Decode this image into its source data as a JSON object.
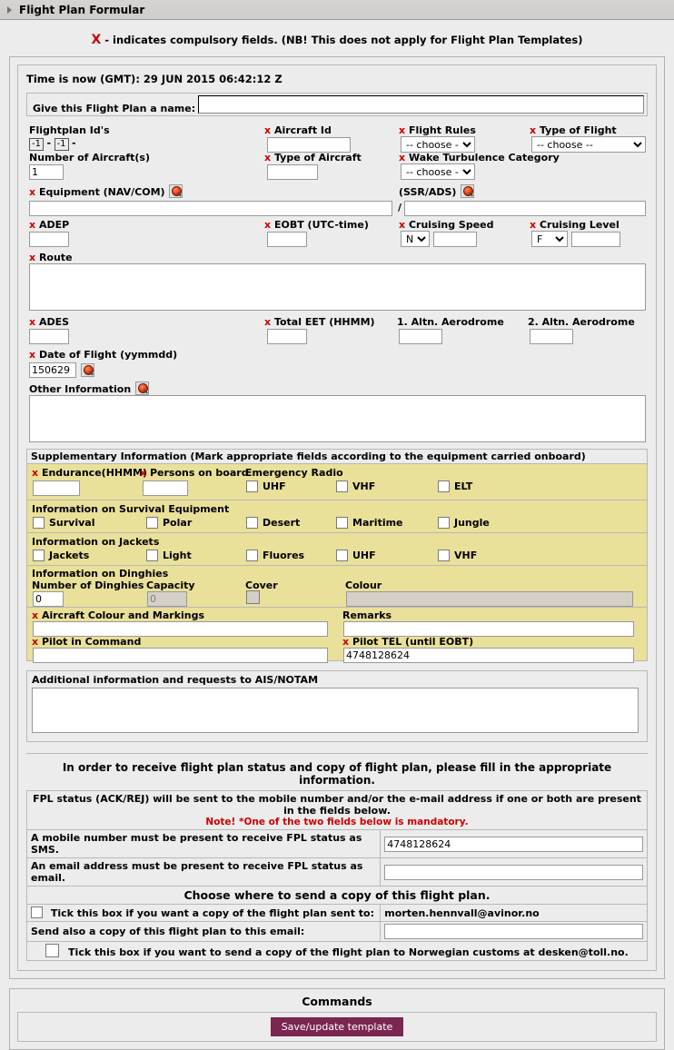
{
  "window": {
    "title": "Flight Plan Formular",
    "expander_icon": "triangle-right-icon"
  },
  "notice": {
    "xmark": "X",
    "text": "- indicates compulsory fields. (NB! This does not apply for Flight Plan Templates)"
  },
  "header": {
    "time_label": "Time is now (GMT): 29 JUN 2015 06:42:12 Z",
    "name_label": "Give this Flight Plan a name:",
    "name_value": ""
  },
  "fields": {
    "flightplan_ids_label": "Flightplan Id's",
    "flightplan_id_1": "-1",
    "flightplan_id_2": "-1",
    "flightplan_id_sep": "-",
    "flightplan_id_tail": "-",
    "aircraft_id_label": "Aircraft Id",
    "aircraft_id_value": "",
    "flight_rules_label": "Flight Rules",
    "flight_rules_value": "-- choose --",
    "type_of_flight_label": "Type of Flight",
    "type_of_flight_value": "-- choose --",
    "number_of_aircraft_label": "Number of Aircraft(s)",
    "number_of_aircraft_value": "1",
    "type_of_aircraft_label": "Type of Aircraft",
    "type_of_aircraft_value": "",
    "wake_turbulence_label": "Wake Turbulence Category",
    "wake_turbulence_value": "-- choose --",
    "equipment_label": "Equipment (NAV/COM)",
    "equipment_value": "",
    "ssr_ads_label": "(SSR/ADS)",
    "ssr_ads_sep": "/",
    "ssr_ads_value": "",
    "adep_label": "ADEP",
    "adep_value": "",
    "eobt_label": "EOBT (UTC-time)",
    "eobt_value": "",
    "cruising_speed_label": "Cruising Speed",
    "cruising_speed_prefix": "N",
    "cruising_speed_value": "",
    "cruising_level_label": "Cruising Level",
    "cruising_level_prefix": "F",
    "cruising_level_value": "",
    "route_label": "Route",
    "route_value": "",
    "ades_label": "ADES",
    "ades_value": "",
    "total_eet_label": "Total EET (HHMM)",
    "total_eet_value": "",
    "altn1_label": "1. Altn. Aerodrome",
    "altn1_value": "",
    "altn2_label": "2. Altn. Aerodrome",
    "altn2_value": "",
    "date_of_flight_label": "Date of Flight (yymmdd)",
    "date_of_flight_value": "150629",
    "other_information_label": "Other Information",
    "other_information_value": "",
    "magnifier_icon": "magnifier-icon"
  },
  "supplementary": {
    "heading": "Supplementary Information (Mark appropriate fields according to the equipment carried onboard)",
    "endurance_label": "Endurance(HHMM)",
    "endurance_value": "",
    "persons_label": "Persons on board",
    "persons_value": "",
    "emergency_radio_label": "Emergency Radio",
    "emergency_radio": [
      {
        "label": "UHF",
        "checked": false
      },
      {
        "label": "VHF",
        "checked": false
      },
      {
        "label": "ELT",
        "checked": false
      }
    ],
    "survival_heading": "Information on Survival Equipment",
    "survival": [
      {
        "label": "Survival",
        "checked": false
      },
      {
        "label": "Polar",
        "checked": false
      },
      {
        "label": "Desert",
        "checked": false
      },
      {
        "label": "Maritime",
        "checked": false
      },
      {
        "label": "Jungle",
        "checked": false
      }
    ],
    "jackets_heading": "Information on Jackets",
    "jackets": [
      {
        "label": "Jackets",
        "checked": false
      },
      {
        "label": "Light",
        "checked": false
      },
      {
        "label": "Fluores",
        "checked": false
      },
      {
        "label": "UHF",
        "checked": false
      },
      {
        "label": "VHF",
        "checked": false
      }
    ],
    "dinghies_heading": "Information on Dinghies",
    "dinghies_number_label": "Number of Dinghies",
    "dinghies_number_value": "0",
    "dinghies_capacity_label": "Capacity",
    "dinghies_capacity_value": "0",
    "dinghies_cover_label": "Cover",
    "dinghies_cover_checked": false,
    "dinghies_colour_label": "Colour",
    "dinghies_colour_value": "",
    "aircraft_colour_label": "Aircraft Colour and Markings",
    "aircraft_colour_value": "",
    "remarks_label": "Remarks",
    "remarks_value": "",
    "pilot_in_command_label": "Pilot in Command",
    "pilot_in_command_value": "",
    "pilot_tel_label": "Pilot TEL (until EOBT)",
    "pilot_tel_value": "4748128624"
  },
  "ais": {
    "label": "Additional information and requests to AIS/NOTAM",
    "value": ""
  },
  "status": {
    "title": "In order to receive flight plan status and copy of flight plan, please fill in  the appropriate information.",
    "fpl_note": "FPL status  (ACK/REJ) will be sent to the mobile number and/or the e-mail address if one or both are present in the fields below.",
    "mandatory_note": "Note! *One of the two fields below is mandatory.",
    "mobile_label": "A mobile number must be present to receive FPL status as SMS.",
    "mobile_value": "4748128624",
    "email_label": "An email address must be present to receive FPL status as email.",
    "email_value": "",
    "choose_title": "Choose where to send a copy of this flight plan.",
    "copy_checkbox_label": "Tick this box if you want a copy of the flight plan sent to:",
    "copy_checkbox_checked": false,
    "copy_email_address": "morten.hennvall@avinor.no",
    "send_also_label": "Send also a copy of this flight plan to this email:",
    "send_also_value": "",
    "customs_label": "Tick this box if you want to send a copy of the flight plan to Norwegian customs at desken@toll.no.",
    "customs_checked": false
  },
  "commands": {
    "title": "Commands",
    "save_label": "Save/update template"
  },
  "colors": {
    "accent_red": "#cc0000",
    "yellow_band": "#e9e09a",
    "button": "#7b2650",
    "chrome": "#ececec"
  }
}
